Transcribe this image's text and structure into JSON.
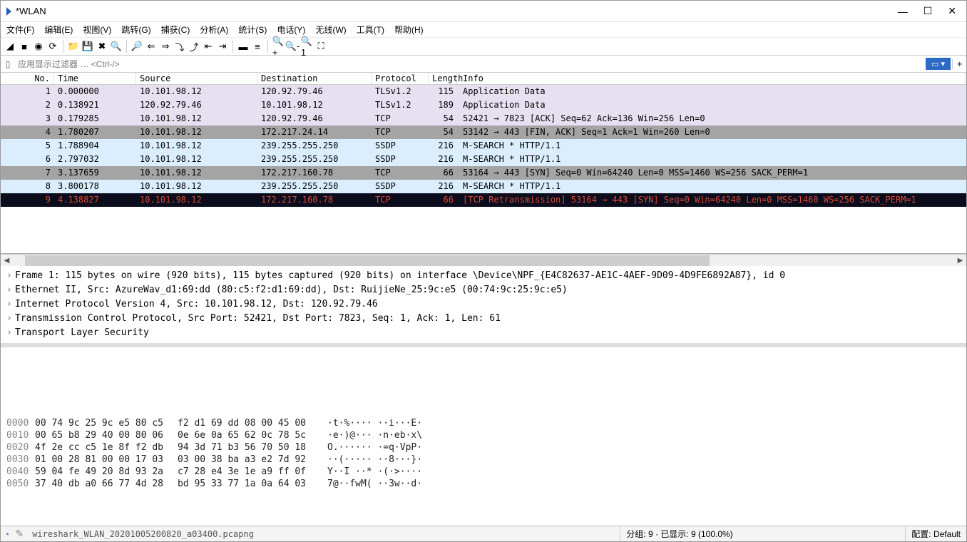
{
  "title": "*WLAN",
  "window_buttons": {
    "min": "—",
    "max": "☐",
    "close": "✕"
  },
  "menu": [
    "文件(F)",
    "编辑(E)",
    "视图(V)",
    "跳转(G)",
    "捕获(C)",
    "分析(A)",
    "统计(S)",
    "电话(Y)",
    "无线(W)",
    "工具(T)",
    "帮助(H)"
  ],
  "filter_placeholder": "应用显示过滤器 … <Ctrl-/>",
  "columns": {
    "no": "No.",
    "time": "Time",
    "src": "Source",
    "dst": "Destination",
    "proto": "Protocol",
    "len": "Length",
    "info": "Info"
  },
  "packets": [
    {
      "no": "1",
      "time": "0.000000",
      "src": "10.101.98.12",
      "dst": "120.92.79.46",
      "proto": "TLSv1.2",
      "len": "115",
      "info": "Application Data",
      "style": "row-tls"
    },
    {
      "no": "2",
      "time": "0.138921",
      "src": "120.92.79.46",
      "dst": "10.101.98.12",
      "proto": "TLSv1.2",
      "len": "189",
      "info": "Application Data",
      "style": "row-tls"
    },
    {
      "no": "3",
      "time": "0.179285",
      "src": "10.101.98.12",
      "dst": "120.92.79.46",
      "proto": "TCP",
      "len": "54",
      "info": "52421 → 7823 [ACK] Seq=62 Ack=136 Win=256 Len=0",
      "style": "row-tls"
    },
    {
      "no": "4",
      "time": "1.780207",
      "src": "10.101.98.12",
      "dst": "172.217.24.14",
      "proto": "TCP",
      "len": "54",
      "info": "53142 → 443 [FIN, ACK] Seq=1 Ack=1 Win=260 Len=0",
      "style": "row-selected"
    },
    {
      "no": "5",
      "time": "1.788904",
      "src": "10.101.98.12",
      "dst": "239.255.255.250",
      "proto": "SSDP",
      "len": "216",
      "info": "M-SEARCH * HTTP/1.1",
      "style": "row-ssdp"
    },
    {
      "no": "6",
      "time": "2.797032",
      "src": "10.101.98.12",
      "dst": "239.255.255.250",
      "proto": "SSDP",
      "len": "216",
      "info": "M-SEARCH * HTTP/1.1",
      "style": "row-ssdp"
    },
    {
      "no": "7",
      "time": "3.137659",
      "src": "10.101.98.12",
      "dst": "172.217.160.78",
      "proto": "TCP",
      "len": "66",
      "info": "53164 → 443 [SYN] Seq=0 Win=64240 Len=0 MSS=1460 WS=256 SACK_PERM=1",
      "style": "row-syn"
    },
    {
      "no": "8",
      "time": "3.800178",
      "src": "10.101.98.12",
      "dst": "239.255.255.250",
      "proto": "SSDP",
      "len": "216",
      "info": "M-SEARCH * HTTP/1.1",
      "style": "row-ssdp"
    },
    {
      "no": "9",
      "time": "4.138827",
      "src": "10.101.98.12",
      "dst": "172.217.160.78",
      "proto": "TCP",
      "len": "66",
      "info": "[TCP Retransmission] 53164 → 443 [SYN] Seq=0 Win=64240 Len=0 MSS=1460 WS=256 SACK_PERM=1",
      "style": "row-retx"
    }
  ],
  "details": [
    "Frame 1: 115 bytes on wire (920 bits), 115 bytes captured (920 bits) on interface \\Device\\NPF_{E4C82637-AE1C-4AEF-9D09-4D9FE6892A87}, id 0",
    "Ethernet II, Src: AzureWav_d1:69:dd (80:c5:f2:d1:69:dd), Dst: RuijieNe_25:9c:e5 (00:74:9c:25:9c:e5)",
    "Internet Protocol Version 4, Src: 10.101.98.12, Dst: 120.92.79.46",
    "Transmission Control Protocol, Src Port: 52421, Dst Port: 7823, Seq: 1, Ack: 1, Len: 61",
    "Transport Layer Security"
  ],
  "bytes": [
    {
      "off": "0000",
      "h1": "00 74 9c 25 9c e5 80 c5",
      "h2": "f2 d1 69 dd 08 00 45 00",
      "asc": "·t·%···· ··i···E·"
    },
    {
      "off": "0010",
      "h1": "00 65 b8 29 40 00 80 06",
      "h2": "0e 6e 0a 65 62 0c 78 5c",
      "asc": "·e·)@··· ·n·eb·x\\"
    },
    {
      "off": "0020",
      "h1": "4f 2e cc c5 1e 8f f2 db",
      "h2": "94 3d 71 b3 56 70 50 18",
      "asc": "O.······ ·=q·VpP·"
    },
    {
      "off": "0030",
      "h1": "01 00 28 81 00 00 17 03",
      "h2": "03 00 38 ba a3 e2 7d 92",
      "asc": "··(····· ··8···}·"
    },
    {
      "off": "0040",
      "h1": "59 04 fe 49 20 8d 93 2a",
      "h2": "c7 28 e4 3e 1e a9 ff 0f",
      "asc": "Y··I ··* ·(·>····"
    },
    {
      "off": "0050",
      "h1": "37 40 db a0 66 77 4d 28",
      "h2": "bd 95 33 77 1a 0a 64 03",
      "asc": "7@··fwM( ··3w··d·"
    }
  ],
  "status": {
    "file": "wireshark_WLAN_20201005200820_a03400.pcapng",
    "packets": "分组: 9 · 已显示: 9 (100.0%)",
    "profile": "配置: Default"
  },
  "toolbar_icons": [
    "◢",
    "■",
    "◉",
    "⟳",
    "",
    "📁",
    "💾",
    "✖",
    "🔍",
    "",
    "🔎",
    "⇐",
    "⇒",
    "⤵",
    "⤴",
    "⇤",
    "⇥",
    "",
    "▬",
    "≡",
    "",
    "🔍+",
    "🔍-",
    "🔍1",
    "⛶"
  ]
}
